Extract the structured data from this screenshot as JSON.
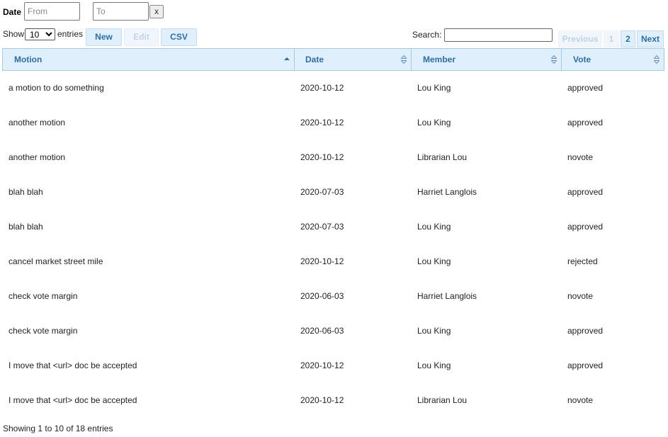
{
  "filter": {
    "date_label": "Date",
    "from_placeholder": "From",
    "to_placeholder": "To",
    "clear_label": "x"
  },
  "length": {
    "show_label": "Show",
    "selected": "10",
    "entries_label": "entries"
  },
  "toolbar": {
    "new_label": "New",
    "edit_label": "Edit",
    "csv_label": "CSV"
  },
  "search": {
    "label": "Search:",
    "value": ""
  },
  "pagination": {
    "previous_label": "Previous",
    "page1": "1",
    "page2": "2",
    "next_label": "Next"
  },
  "table": {
    "columns": [
      "Motion",
      "Date",
      "Member",
      "Vote"
    ],
    "rows": [
      [
        "a motion to do something",
        "2020-10-12",
        "Lou King",
        "approved"
      ],
      [
        "another motion",
        "2020-10-12",
        "Lou King",
        "approved"
      ],
      [
        "another motion",
        "2020-10-12",
        "Librarian Lou",
        "novote"
      ],
      [
        "blah blah",
        "2020-07-03",
        "Harriet Langlois",
        "approved"
      ],
      [
        "blah blah",
        "2020-07-03",
        "Lou King",
        "approved"
      ],
      [
        "cancel market street mile",
        "2020-10-12",
        "Lou King",
        "rejected"
      ],
      [
        "check vote margin",
        "2020-06-03",
        "Harriet Langlois",
        "novote"
      ],
      [
        "check vote margin",
        "2020-06-03",
        "Lou King",
        "approved"
      ],
      [
        "I move that <url> doc be accepted",
        "2020-10-12",
        "Lou King",
        "approved"
      ],
      [
        "I move that <url> doc be accepted",
        "2020-10-12",
        "Librarian Lou",
        "novote"
      ]
    ]
  },
  "info": {
    "text": "Showing 1 to 10 of 18 entries"
  }
}
